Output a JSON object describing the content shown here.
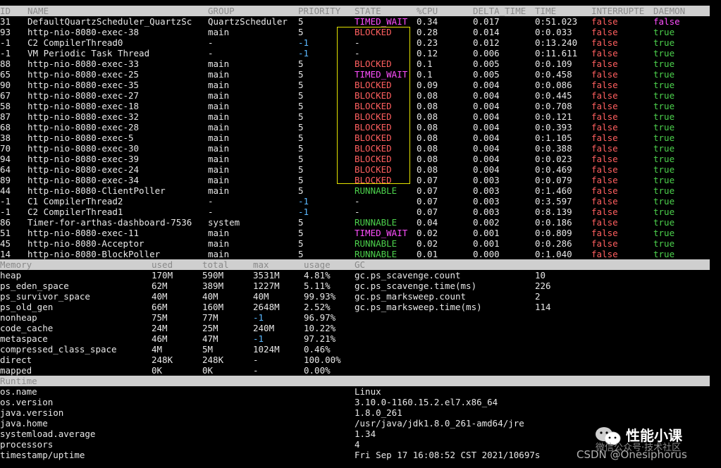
{
  "threads": {
    "headers": [
      "ID",
      "NAME",
      "GROUP",
      "PRIORITY",
      "STATE",
      "%CPU",
      "DELTA_TIME",
      "TIME",
      "INTERRUPTE",
      "DAEMON"
    ],
    "rows": [
      [
        "31",
        "DefaultQuartzScheduler_QuartzSc",
        "QuartzScheduler",
        "5",
        "TIMED_WAIT",
        "0.34",
        "0.017",
        "0:51.023",
        "false",
        "false"
      ],
      [
        "93",
        "http-nio-8080-exec-38",
        "main",
        "5",
        "BLOCKED",
        "0.28",
        "0.014",
        "0:0.033",
        "false",
        "true"
      ],
      [
        "-1",
        "C2 CompilerThread0",
        "-",
        "-1",
        "-",
        "0.23",
        "0.012",
        "0:13.240",
        "false",
        "true"
      ],
      [
        "-1",
        "VM Periodic Task Thread",
        "-",
        "-1",
        "-",
        "0.12",
        "0.006",
        "0:11.611",
        "false",
        "true"
      ],
      [
        "88",
        "http-nio-8080-exec-33",
        "main",
        "5",
        "BLOCKED",
        "0.1",
        "0.005",
        "0:0.109",
        "false",
        "true"
      ],
      [
        "65",
        "http-nio-8080-exec-25",
        "main",
        "5",
        "TIMED_WAIT",
        "0.1",
        "0.005",
        "0:0.458",
        "false",
        "true"
      ],
      [
        "90",
        "http-nio-8080-exec-35",
        "main",
        "5",
        "BLOCKED",
        "0.09",
        "0.004",
        "0:0.086",
        "false",
        "true"
      ],
      [
        "67",
        "http-nio-8080-exec-27",
        "main",
        "5",
        "BLOCKED",
        "0.08",
        "0.004",
        "0:0.445",
        "false",
        "true"
      ],
      [
        "58",
        "http-nio-8080-exec-18",
        "main",
        "5",
        "BLOCKED",
        "0.08",
        "0.004",
        "0:0.708",
        "false",
        "true"
      ],
      [
        "87",
        "http-nio-8080-exec-32",
        "main",
        "5",
        "BLOCKED",
        "0.08",
        "0.004",
        "0:0.121",
        "false",
        "true"
      ],
      [
        "68",
        "http-nio-8080-exec-28",
        "main",
        "5",
        "BLOCKED",
        "0.08",
        "0.004",
        "0:0.393",
        "false",
        "true"
      ],
      [
        "38",
        "http-nio-8080-exec-5",
        "main",
        "5",
        "BLOCKED",
        "0.08",
        "0.004",
        "0:1.105",
        "false",
        "true"
      ],
      [
        "70",
        "http-nio-8080-exec-30",
        "main",
        "5",
        "BLOCKED",
        "0.08",
        "0.004",
        "0:0.388",
        "false",
        "true"
      ],
      [
        "94",
        "http-nio-8080-exec-39",
        "main",
        "5",
        "BLOCKED",
        "0.08",
        "0.004",
        "0:0.023",
        "false",
        "true"
      ],
      [
        "64",
        "http-nio-8080-exec-24",
        "main",
        "5",
        "BLOCKED",
        "0.08",
        "0.004",
        "0:0.469",
        "false",
        "true"
      ],
      [
        "89",
        "http-nio-8080-exec-34",
        "main",
        "5",
        "BLOCKED",
        "0.07",
        "0.003",
        "0:0.079",
        "false",
        "true"
      ],
      [
        "44",
        "http-nio-8080-ClientPoller",
        "main",
        "5",
        "RUNNABLE",
        "0.07",
        "0.003",
        "0:1.460",
        "false",
        "true"
      ],
      [
        "-1",
        "C1 CompilerThread2",
        "-",
        "-1",
        "-",
        "0.07",
        "0.003",
        "0:3.597",
        "false",
        "true"
      ],
      [
        "-1",
        "C2 CompilerThread1",
        "-",
        "-1",
        "-",
        "0.07",
        "0.003",
        "0:8.139",
        "false",
        "true"
      ],
      [
        "86",
        "Timer-for-arthas-dashboard-7536",
        "system",
        "5",
        "RUNNABLE",
        "0.04",
        "0.002",
        "0:0.186",
        "false",
        "true"
      ],
      [
        "51",
        "http-nio-8080-exec-11",
        "main",
        "5",
        "TIMED_WAIT",
        "0.02",
        "0.001",
        "0:0.809",
        "false",
        "true"
      ],
      [
        "45",
        "http-nio-8080-Acceptor",
        "main",
        "5",
        "RUNNABLE",
        "0.02",
        "0.001",
        "0:0.286",
        "false",
        "true"
      ],
      [
        "14",
        "http-nio-8080-BlockPoller",
        "main",
        "5",
        "RUNNABLE",
        "0.01",
        "0.000",
        "0:1.040",
        "false",
        "true"
      ]
    ]
  },
  "memory": {
    "headers": [
      "Memory",
      "used",
      "total",
      "max",
      "usage",
      "GC"
    ],
    "rows": [
      [
        "heap",
        "170M",
        "590M",
        "3531M",
        "4.81%"
      ],
      [
        "ps_eden_space",
        "62M",
        "389M",
        "1227M",
        "5.11%"
      ],
      [
        "ps_survivor_space",
        "40M",
        "40M",
        "40M",
        "99.93%"
      ],
      [
        "ps_old_gen",
        "66M",
        "160M",
        "2648M",
        "2.52%"
      ],
      [
        "nonheap",
        "75M",
        "77M",
        "-1",
        "96.97%"
      ],
      [
        "code_cache",
        "24M",
        "25M",
        "240M",
        "10.22%"
      ],
      [
        "metaspace",
        "46M",
        "47M",
        "-1",
        "97.21%"
      ],
      [
        "compressed_class_space",
        "4M",
        "5M",
        "1024M",
        "0.46%"
      ],
      [
        "direct",
        "248K",
        "248K",
        "-",
        "100.00%"
      ],
      [
        "mapped",
        "0K",
        "0K",
        "-",
        "0.00%"
      ]
    ],
    "gc": [
      [
        "gc.ps_scavenge.count",
        "10"
      ],
      [
        "gc.ps_scavenge.time(ms)",
        "226"
      ],
      [
        "gc.ps_marksweep.count",
        "2"
      ],
      [
        "gc.ps_marksweep.time(ms)",
        "114"
      ]
    ]
  },
  "runtime": {
    "header": "Runtime",
    "rows": [
      [
        "os.name",
        "Linux"
      ],
      [
        "os.version",
        "3.10.0-1160.15.2.el7.x86_64"
      ],
      [
        "java.version",
        "1.8.0_261"
      ],
      [
        "java.home",
        "/usr/java/jdk1.8.0_261-amd64/jre"
      ],
      [
        "systemload.average",
        "1.34"
      ],
      [
        "processors",
        "4"
      ],
      [
        "timestamp/uptime",
        "Fri Sep 17 16:08:52 CST 2021/10697s"
      ]
    ]
  },
  "watermark": {
    "brand": "性能小课",
    "sub": "微信公众号·技术社区",
    "csdn": "CSDN @Onesiphorus"
  },
  "colors": {
    "blocked": "#ff5f5f",
    "runnable": "#4cd14c",
    "timed_wait": "#ff4fff",
    "false": "#ff5f5f",
    "true": "#4cd14c",
    "negative_priority": "#5ab8ff",
    "highlight_frame": "#e4e400"
  }
}
